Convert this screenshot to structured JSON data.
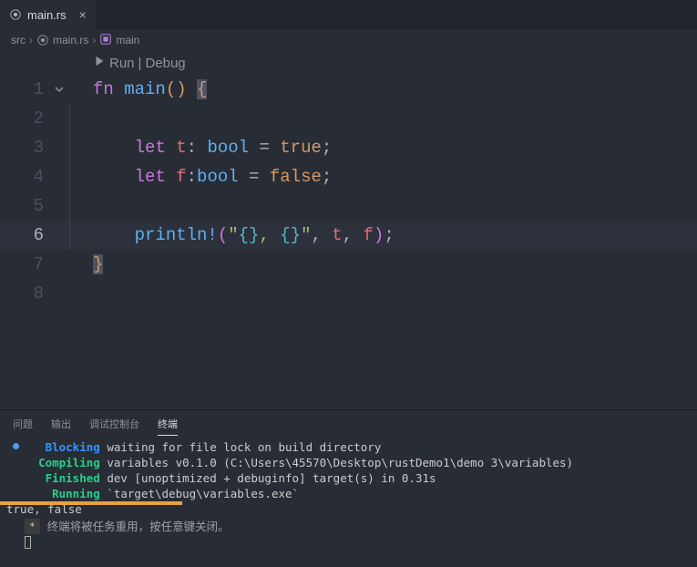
{
  "tab": {
    "name": "main.rs"
  },
  "breadcrumbs": {
    "a": "src",
    "b": "main.rs",
    "c": "main"
  },
  "codelens": {
    "run": "Run",
    "sep": "|",
    "debug": "Debug"
  },
  "gutter": {
    "l1": "1",
    "l2": "2",
    "l3": "3",
    "l4": "4",
    "l5": "5",
    "l6": "6",
    "l7": "7",
    "l8": "8"
  },
  "code": {
    "l1": {
      "fn": "fn",
      "name": "main",
      "p": "()",
      "ob": "{"
    },
    "l3": {
      "let": "let",
      "v": "t",
      "colon": ": ",
      "ty": "bool",
      "eq": " = ",
      "val": "true",
      "semi": ";"
    },
    "l4": {
      "let": "let",
      "v": "f",
      "colon": ":",
      "ty": "bool",
      "eq": " = ",
      "val": "false",
      "semi": ";"
    },
    "l6": {
      "mac": "println!",
      "op": "(",
      "q1": "\"",
      "ph1": "{}",
      "mid": ", ",
      "ph2": "{}",
      "q2": "\"",
      "c1": ", ",
      "a": "t",
      "c2": ", ",
      "b": "f",
      "cp": ")",
      "semi": ";"
    },
    "l7": {
      "cb": "}"
    }
  },
  "panel": {
    "tabs": {
      "problems": "问题",
      "output": "输出",
      "debugConsole": "调试控制台",
      "terminal": "终端"
    },
    "lines": {
      "blocking_kw": "Blocking",
      "blocking": " waiting for file lock on build directory",
      "compiling_kw": "Compiling",
      "compiling": " variables v0.1.0 (C:\\Users\\45570\\Desktop\\rustDemo1\\demo 3\\variables)",
      "finished_kw": "Finished",
      "finished": " dev [unoptimized + debuginfo] target(s) in 0.31s",
      "running_kw": "Running",
      "running": " `target\\debug\\variables.exe`",
      "output": "true, false",
      "reuse_badge": "*",
      "reuse": "终端将被任务重用，按任意键关闭。"
    }
  }
}
